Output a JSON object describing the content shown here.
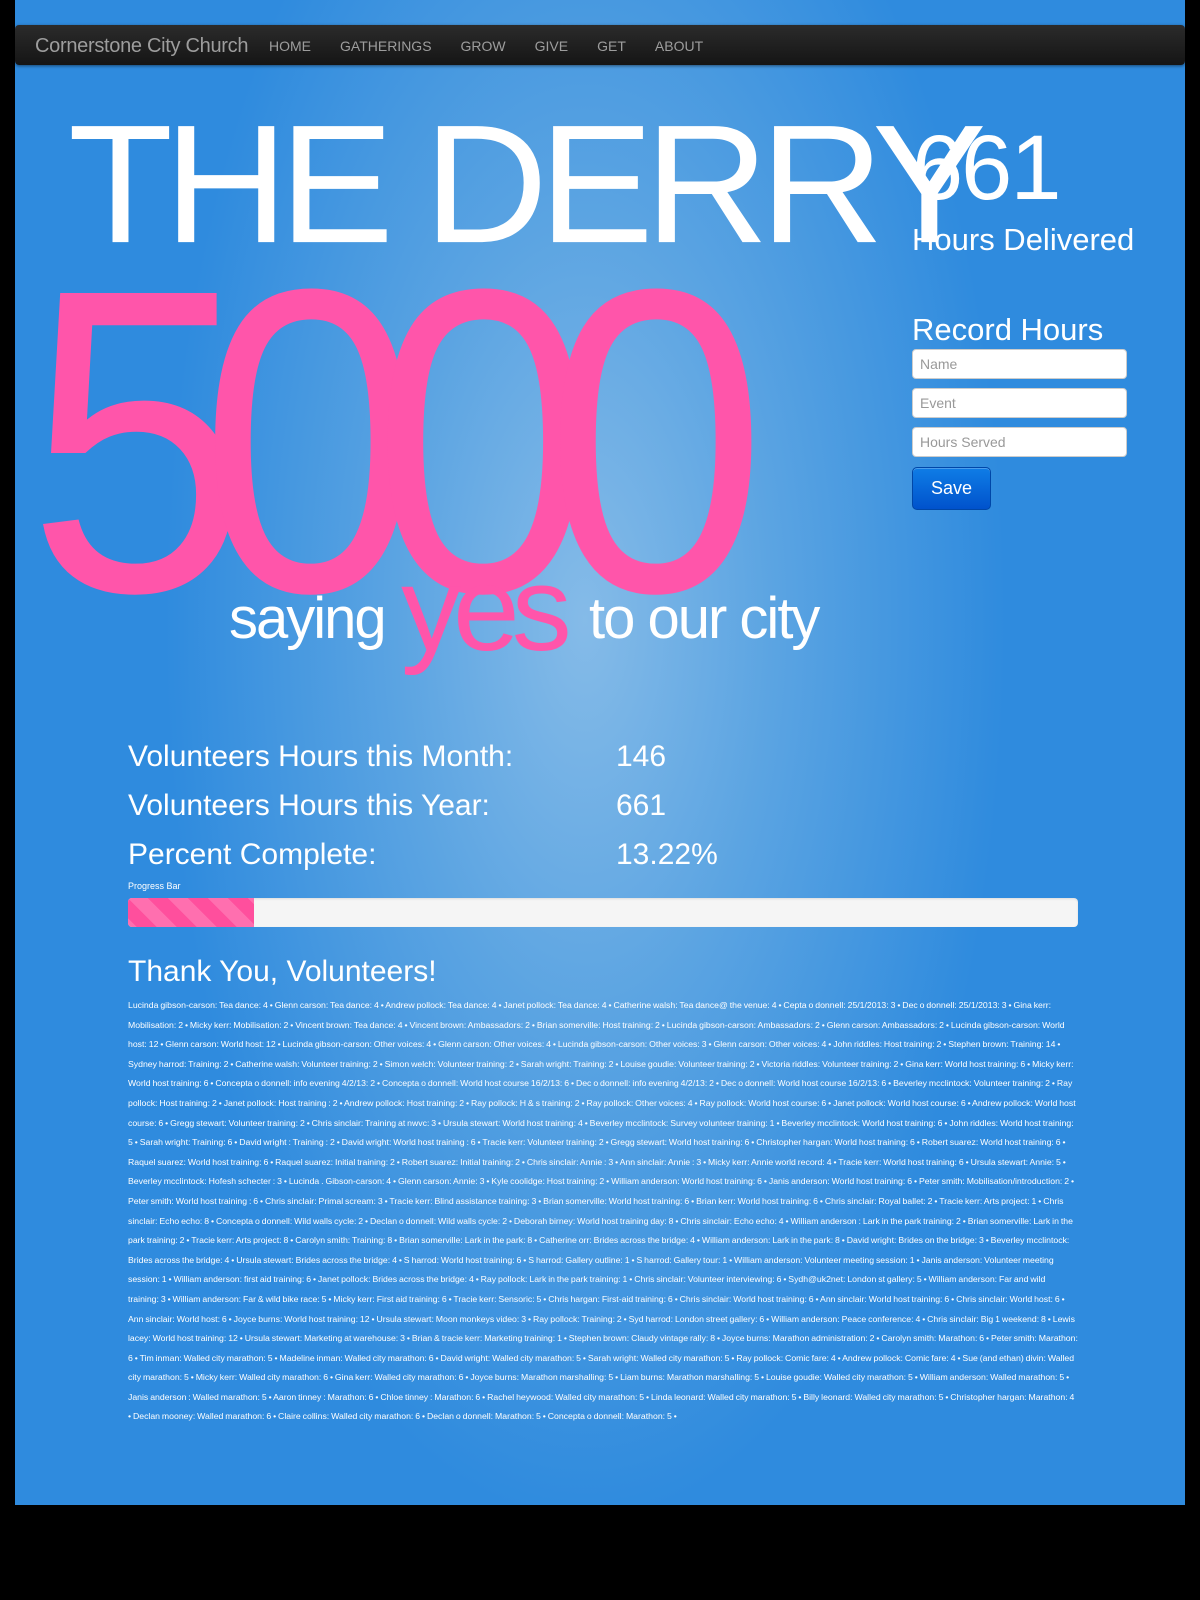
{
  "navbar": {
    "brand": "Cornerstone City Church",
    "items": [
      "HOME",
      "GATHERINGS",
      "GROW",
      "GIVE",
      "GET",
      "ABOUT"
    ]
  },
  "hero": {
    "title_top": "THE DERRY",
    "number": "5000",
    "tagline_before": "saying",
    "tagline_highlight": "yes",
    "tagline_after": "to our city"
  },
  "stats": {
    "hours_delivered": "661",
    "hours_delivered_label": "Hours Delivered",
    "month_label": "Volunteers Hours this Month:",
    "month_value": "146",
    "year_label": "Volunteers Hours this Year:",
    "year_value": "661",
    "percent_label": "Percent Complete:",
    "percent_value": "13.22%",
    "progress_caption": "Progress Bar",
    "progress_fraction": 0.1322
  },
  "form": {
    "title": "Record Hours",
    "name_placeholder": "Name",
    "event_placeholder": "Event",
    "hours_placeholder": "Hours Served",
    "save_label": "Save"
  },
  "volunteers": {
    "title": "Thank You, Volunteers!",
    "entries": [
      "Lucinda gibson-carson: Tea dance: 4",
      "Glenn carson: Tea dance: 4",
      "Andrew pollock: Tea dance: 4",
      "Janet pollock: Tea dance: 4",
      "Catherine walsh: Tea dance@ the venue: 4",
      "Cepta o donnell: 25/1/2013: 3",
      "Dec o donnell: 25/1/2013: 3",
      "Gina kerr: Mobilisation: 2",
      "Micky kerr: Mobilisation: 2",
      "Vincent brown: Tea dance: 4",
      "Vincent brown: Ambassadors: 2",
      "Brian somerville: Host training: 2",
      "Lucinda gibson-carson: Ambassadors: 2",
      "Glenn carson: Ambassadors: 2",
      "Lucinda gibson-carson: World host: 12",
      "Glenn carson: World host: 12",
      "Lucinda gibson-carson: Other voices: 4",
      "Glenn carson: Other voices: 4",
      "Lucinda gibson-carson: Other voices: 3",
      "Glenn carson: Other voices: 4",
      "John riddles: Host training: 2",
      "Stephen brown: Training: 14",
      "Sydney harrod: Training: 2",
      "Catherine walsh: Volunteer training: 2",
      "Simon welch: Volunteer training: 2",
      "Sarah wright: Training: 2",
      "Louise goudie: Volunteer training: 2",
      "Victoria riddles: Volunteer training: 2",
      "Gina kerr: World host training: 6",
      "Micky kerr: World host training: 6",
      "Concepta o donnell: info evening 4/2/13: 2",
      "Concepta o donnell: World host course 16/2/13: 6",
      "Dec o donnell: info evening 4/2/13: 2",
      "Dec o donnell: World host course 16/2/13: 6",
      "Beverley mcclintock: Volunteer training: 2",
      "Ray pollock: Host training: 2",
      "Janet pollock: Host training : 2",
      "Andrew pollock: Host training: 2",
      "Ray pollock: H & s training: 2",
      "Ray pollock: Other voices: 4",
      "Ray pollock: World host course: 6",
      "Janet pollock: World host course: 6",
      "Andrew pollock: World host course: 6",
      "Gregg stewart: Volunteer training: 2",
      "Chris sinclair: Training at nwvc: 3",
      "Ursula stewart: World host training: 4",
      "Beverley mcclintock: Survey volunteer training: 1",
      "Beverley mcclintock: World host training: 6",
      "John riddles: World host training: 5",
      "Sarah wright: Training: 6",
      "David wright : Training : 2",
      "David wright: World host training : 6",
      "Tracie kerr: Volunteer training: 2",
      "Gregg stewart: World host training: 6",
      "Christopher hargan: World host training: 6",
      "Robert suarez: World host training: 6",
      "Raquel suarez: World host training: 6",
      "Raquel suarez: Initial training: 2",
      "Robert suarez: Initial training: 2",
      "Chris sinclair: Annie : 3",
      "Ann sinclair: Annie : 3",
      "Micky kerr: Annie world record: 4",
      "Tracie kerr: World host training: 6",
      "Ursula stewart: Annie: 5",
      "Beverley mcclintock: Hofesh schecter : 3",
      "Lucinda . Gibson-carson: 4",
      "Glenn carson: Annie: 3",
      "Kyle coolidge: Host training: 2",
      "William anderson: World host training: 6",
      "Janis anderson: World host training: 6",
      "Peter smith: Mobilisation/introduction: 2",
      "Peter smith: World host training : 6",
      "Chris sinclair: Primal scream: 3",
      "Tracie kerr: Blind assistance training: 3",
      "Brian somerville: World host training: 6",
      "Brian kerr: World host training: 6",
      "Chris sinclair: Royal ballet: 2",
      "Tracie kerr: Arts project: 1",
      "Chris sinclair: Echo echo: 8",
      "Concepta o donnell: Wild walls cycle: 2",
      "Declan o donnell: Wild walls cycle: 2",
      "Deborah birney: World host training day: 8",
      "Chris sinclair: Echo echo: 4",
      "William anderson : Lark in the park training: 2",
      "Brian somerville: Lark in the park training: 2",
      "Tracie kerr: Arts project: 8",
      "Carolyn smith: Training: 8",
      "Brian somerville: Lark in the park: 8",
      "Catherine orr: Brides across the bridge: 4",
      "William anderson: Lark in the park: 8",
      "David wright: Brides on the bridge: 3",
      "Beverley mcclintock: Brides across the bridge: 4",
      "Ursula stewart: Brides across the bridge: 4",
      "S harrod: World host training: 6",
      "S harrod: Gallery outline: 1",
      "S harrod: Gallery tour: 1",
      "William anderson: Volunteer meeting session: 1",
      "Janis anderson: Volunteer meeting session: 1",
      "William anderson: first aid training: 6",
      "Janet pollock: Brides across the bridge: 4",
      "Ray pollock: Lark in the park training: 1",
      "Chris sinclair: Volunteer interviewing: 6",
      "Sydh@uk2net: London st gallery: 5",
      "William anderson: Far and wild training: 3",
      "William anderson: Far & wild bike race: 5",
      "Micky kerr: First aid training: 6",
      "Tracie kerr: Sensoric: 5",
      "Chris hargan: First-aid training: 6",
      "Chris sinclair: World host training: 6",
      "Ann sinclair: World host training: 6",
      "Chris sinclair: World host: 6",
      "Ann sinclair: World host: 6",
      "Joyce burns: World host training: 12",
      "Ursula stewart: Moon monkeys video: 3",
      "Ray pollock: Training: 2",
      "Syd harrod: London street gallery: 6",
      "William anderson: Peace conference: 4",
      "Chris sinclair: Big 1 weekend: 8",
      "Lewis lacey: World host training: 12",
      "Ursula stewart: Marketing at warehouse: 3",
      "Brian & tracie kerr: Marketing training: 1",
      "Stephen brown: Claudy vintage rally: 8",
      "Joyce burns: Marathon administration: 2",
      "Carolyn smith: Marathon: 6",
      "Peter smith: Marathon: 6",
      "Tim inman: Walled city marathon: 5",
      "Madeline inman: Walled city marathon: 6",
      "David wright: Walled city marathon: 5",
      "Sarah wright: Walled city marathon: 5",
      "Ray pollock: Comic fare: 4",
      "Andrew pollock: Comic fare: 4",
      "Sue (and ethan) divin: Walled city marathon: 5",
      "Micky kerr: Walled city marathon: 6",
      "Gina kerr: Walled city marathon: 6",
      "Joyce burns: Marathon marshalling: 5",
      "Liam burns: Marathon marshalling: 5",
      "Louise goudie: Walled city marathon: 5",
      "William anderson: Walled marathon: 5",
      "Janis anderson : Walled marathon: 5",
      "Aaron tinney : Marathon: 6",
      "Chloe tinney : Marathon: 6",
      "Rachel heywood: Walled city marathon: 5",
      "Linda leonard: Walled city marathon: 5",
      "Billy leonard: Walled city marathon: 5",
      "Christopher hargan: Marathon: 4",
      "Declan mooney: Walled marathon: 6",
      "Claire collins: Walled city marathon: 6",
      "Declan o donnell: Marathon: 5",
      "Concepta o donnell: Marathon: 5"
    ]
  },
  "colors": {
    "accent_pink": "#ff55aa",
    "background_blue": "#2f8bde",
    "navbar": "#1b1b1b",
    "button": "#0062d6"
  }
}
